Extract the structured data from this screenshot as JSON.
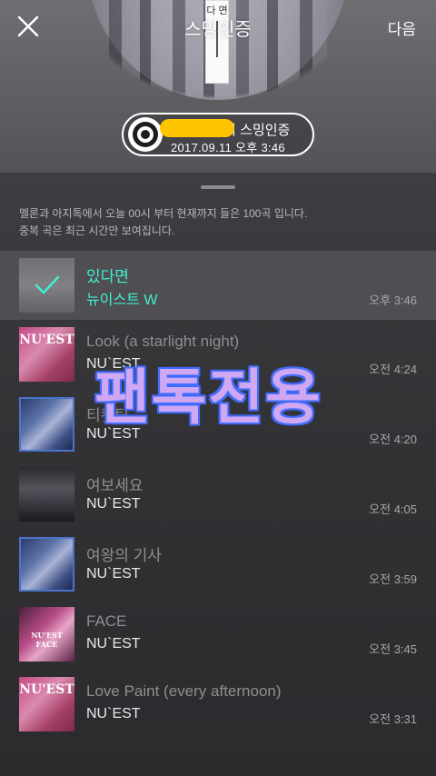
{
  "header": {
    "title": "스밍인증",
    "next_label": "다음",
    "close_icon": "close-icon",
    "bookmark_text": "다 면"
  },
  "certificate": {
    "name_suffix": "의 스밍인증",
    "datetime": "2017.09.11 오후 3:46",
    "icon": "vinyl-disc-icon",
    "redaction_color": "#ffc400"
  },
  "info": {
    "line1": "멜론과 아지톡에서 오늘 00시 부터 현재까지 들은 100곡 입니다.",
    "line2": "중복 곡은 최근 시간만 보여집니다."
  },
  "songs": [
    {
      "title": "있다면",
      "artist": "뉴이스트 W",
      "time": "오후 3:46",
      "selected": true,
      "art": "gray",
      "art_label": ""
    },
    {
      "title": "Look (a starlight night)",
      "artist": "NU`EST",
      "time": "오전 4:24",
      "selected": false,
      "art": "pink",
      "art_label": "NU'EST"
    },
    {
      "title": "티켓팅",
      "artist": "NU`EST",
      "time": "오전 4:20",
      "selected": false,
      "art": "blue",
      "art_label": ""
    },
    {
      "title": "여보세요",
      "artist": "NU`EST",
      "time": "오전 4:05",
      "selected": false,
      "art": "dark",
      "art_label": ""
    },
    {
      "title": "여왕의 기사",
      "artist": "NU`EST",
      "time": "오전 3:59",
      "selected": false,
      "art": "blue",
      "art_label": ""
    },
    {
      "title": "FACE",
      "artist": "NU`EST",
      "time": "오전 3:45",
      "selected": false,
      "art": "face",
      "art_label": "NU'EST FACE"
    },
    {
      "title": "Love Paint (every afternoon)",
      "artist": "NU`EST",
      "time": "오전 3:31",
      "selected": false,
      "art": "pink",
      "art_label": "NU'EST"
    }
  ],
  "watermark": "팬톡전용",
  "colors": {
    "accent": "#3ff0d0",
    "sheet_bg": "#333336",
    "selected_row": "#4f4f53",
    "watermark": "#cfa7f3"
  }
}
